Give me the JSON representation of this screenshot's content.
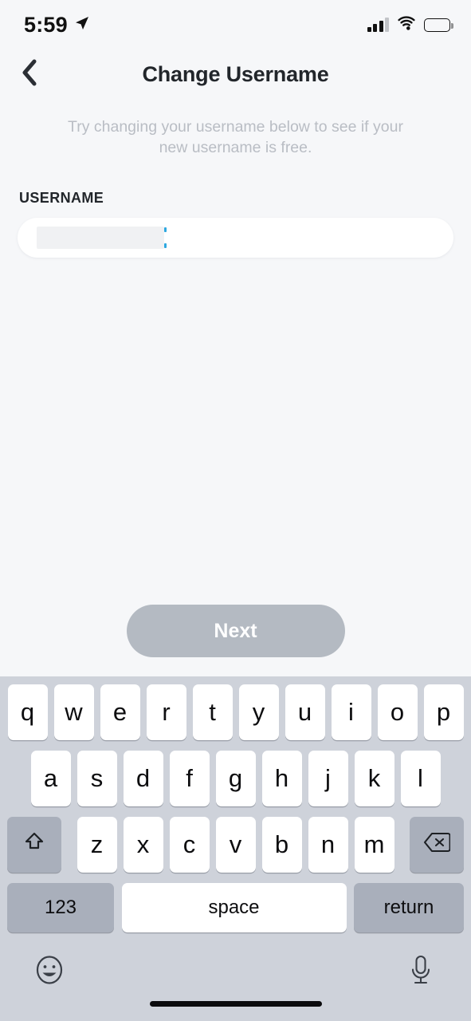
{
  "status_bar": {
    "time": "5:59",
    "location_icon": "location-arrow-icon",
    "cellular_icon": "cellular-signal-icon",
    "wifi_icon": "wifi-icon",
    "battery_icon": "battery-low-icon",
    "battery_color": "#fcc20a",
    "battery_level_percent": 27
  },
  "nav": {
    "back_icon": "chevron-left-icon",
    "title": "Change Username"
  },
  "content": {
    "subtitle": "Try changing your username below to see if your new username is free.",
    "field_label": "USERNAME",
    "input_value": "",
    "input_redacted": true,
    "caret_color": "#2ea8e0"
  },
  "actions": {
    "next_label": "Next",
    "next_enabled": false,
    "next_bg": "#b4bac2"
  },
  "keyboard": {
    "row1": [
      "q",
      "w",
      "e",
      "r",
      "t",
      "y",
      "u",
      "i",
      "o",
      "p"
    ],
    "row2": [
      "a",
      "s",
      "d",
      "f",
      "g",
      "h",
      "j",
      "k",
      "l"
    ],
    "row3": [
      "z",
      "x",
      "c",
      "v",
      "b",
      "n",
      "m"
    ],
    "shift_icon": "shift-arrow-up-icon",
    "delete_icon": "backspace-delete-icon",
    "numbers_label": "123",
    "space_label": "space",
    "return_label": "return",
    "emoji_icon": "emoji-smiley-icon",
    "mic_icon": "microphone-icon",
    "background": "#ced2da"
  },
  "home_indicator": "home-indicator-bar"
}
